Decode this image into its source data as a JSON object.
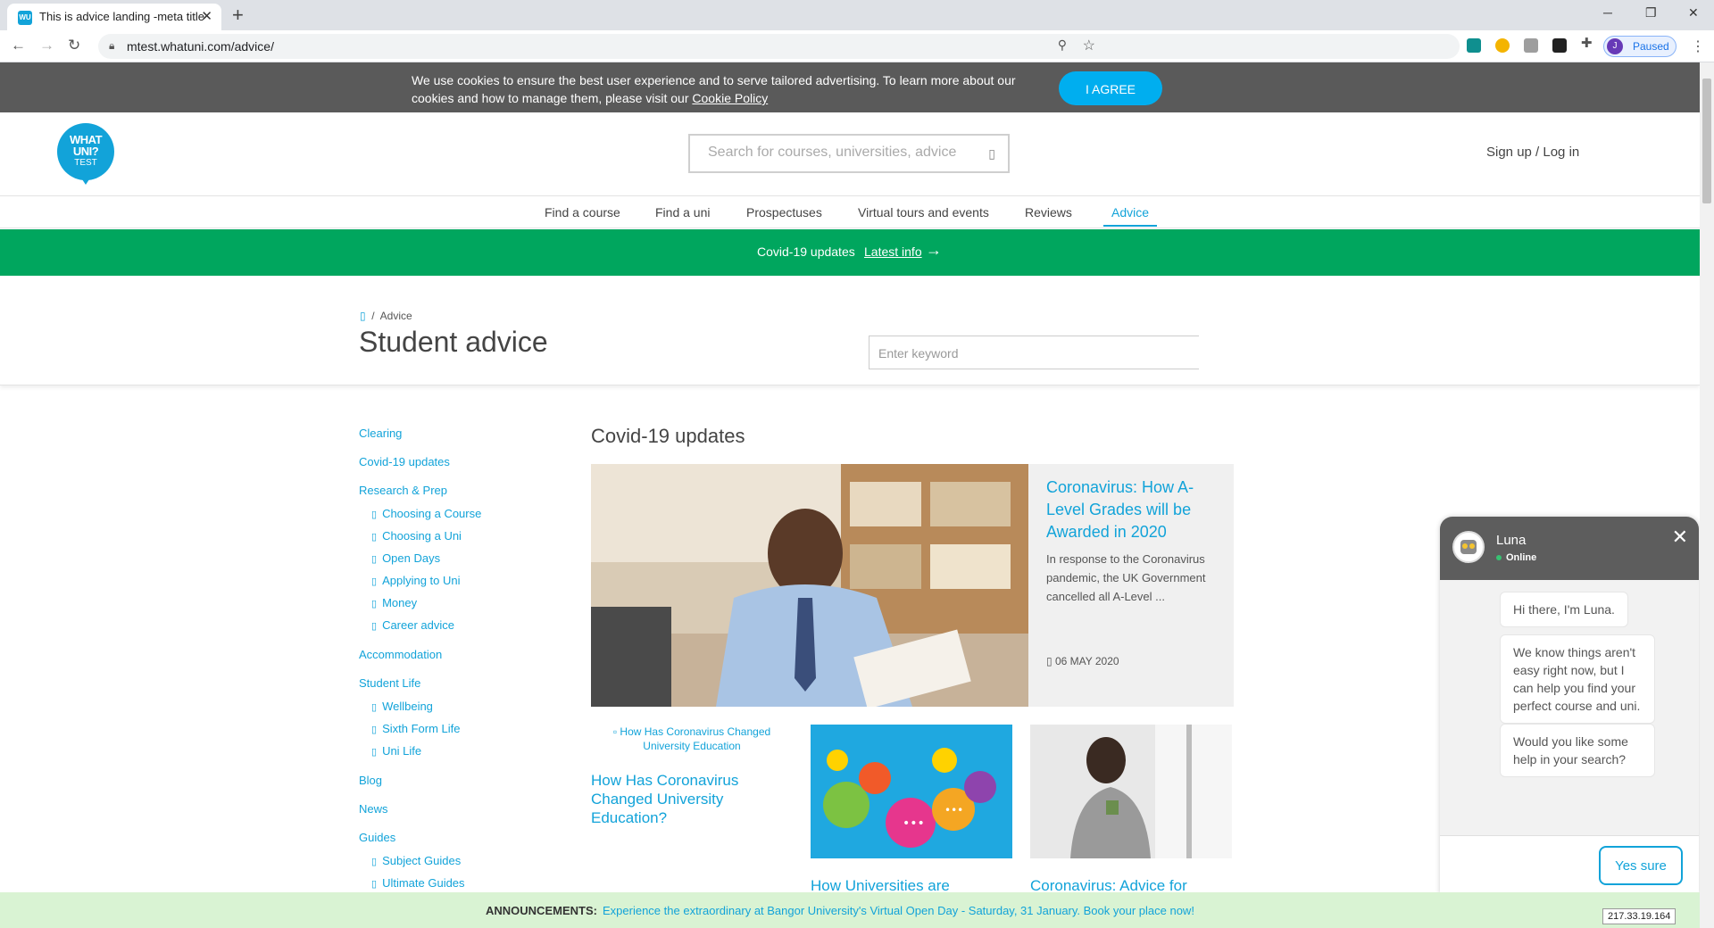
{
  "browser": {
    "tab_title": "This is advice landing -meta title",
    "tab_favicon": "WU",
    "url": "mtest.whatuni.com/advice/",
    "profile_initial": "J",
    "profile_status": "Paused"
  },
  "cookie_banner": {
    "text": "We use cookies to ensure the best user experience and to serve tailored advertising. To learn more about our cookies and how to manage them, please visit our",
    "link": "Cookie Policy",
    "button": "I AGREE"
  },
  "header": {
    "logo_line1": "WHAT",
    "logo_line2": "UNI?",
    "logo_line3": "TEST",
    "search_placeholder": "Search for courses, universities, advice",
    "signin": "Sign up / Log in"
  },
  "nav": [
    {
      "label": "Find a course"
    },
    {
      "label": "Find a uni"
    },
    {
      "label": "Prospectuses"
    },
    {
      "label": "Virtual tours and events"
    },
    {
      "label": "Reviews"
    },
    {
      "label": "Advice",
      "active": true
    }
  ],
  "covid_banner": {
    "text": "Covid-19 updates",
    "link": "Latest info"
  },
  "hero": {
    "breadcrumb_sep": "/",
    "breadcrumb_current": "Advice",
    "title": "Student advice",
    "keyword_placeholder": "Enter keyword"
  },
  "sidebar": [
    {
      "label": "Clearing",
      "level": 1
    },
    {
      "label": "Covid-19 updates",
      "level": 1
    },
    {
      "label": "Research & Prep",
      "level": 1
    },
    {
      "label": "Choosing a Course",
      "level": 2
    },
    {
      "label": "Choosing a Uni",
      "level": 2
    },
    {
      "label": "Open Days",
      "level": 2
    },
    {
      "label": "Applying to Uni",
      "level": 2
    },
    {
      "label": "Money",
      "level": 2
    },
    {
      "label": "Career advice",
      "level": 2
    },
    {
      "label": "Accommodation",
      "level": 1
    },
    {
      "label": "Student Life",
      "level": 1
    },
    {
      "label": "Wellbeing",
      "level": 2
    },
    {
      "label": "Sixth Form Life",
      "level": 2
    },
    {
      "label": "Uni Life",
      "level": 2
    },
    {
      "label": "Blog",
      "level": 1
    },
    {
      "label": "News",
      "level": 1
    },
    {
      "label": "Guides",
      "level": 1
    },
    {
      "label": "Subject Guides",
      "level": 2
    },
    {
      "label": "Ultimate Guides",
      "level": 2
    }
  ],
  "section_title": "Covid-19 updates",
  "featured": {
    "title": "Coronavirus: How A-Level Grades will be Awarded in 2020",
    "description": "In response to the Coronavirus pandemic, the UK Government cancelled all A-Level ...",
    "date": "06 MAY 2020"
  },
  "cards": [
    {
      "image_alt": "How Has Coronavirus Changed University Education",
      "title": "How Has Coronavirus Changed University Education?"
    },
    {
      "title": "How Universities are"
    },
    {
      "title": "Coronavirus: Advice for"
    }
  ],
  "chat": {
    "name": "Luna",
    "status": "Online",
    "messages": [
      "Hi there, I'm Luna.",
      "We know things aren't easy right now, but I can help you find your perfect course and uni.",
      "Would you like some help in your search?"
    ],
    "reply_button": "Yes sure"
  },
  "announcement": {
    "label": "ANNOUNCEMENTS:",
    "text": "Experience the extraordinary at Bangor University's Virtual Open Day - Saturday, 31 January. Book your place now!"
  },
  "ip_badge": "217.33.19.164",
  "colors": {
    "brand_blue": "#12a3d9",
    "covid_green": "#00a65e",
    "cookie_bg": "#5a5a5a",
    "announce_bg": "#d9f3d3"
  }
}
